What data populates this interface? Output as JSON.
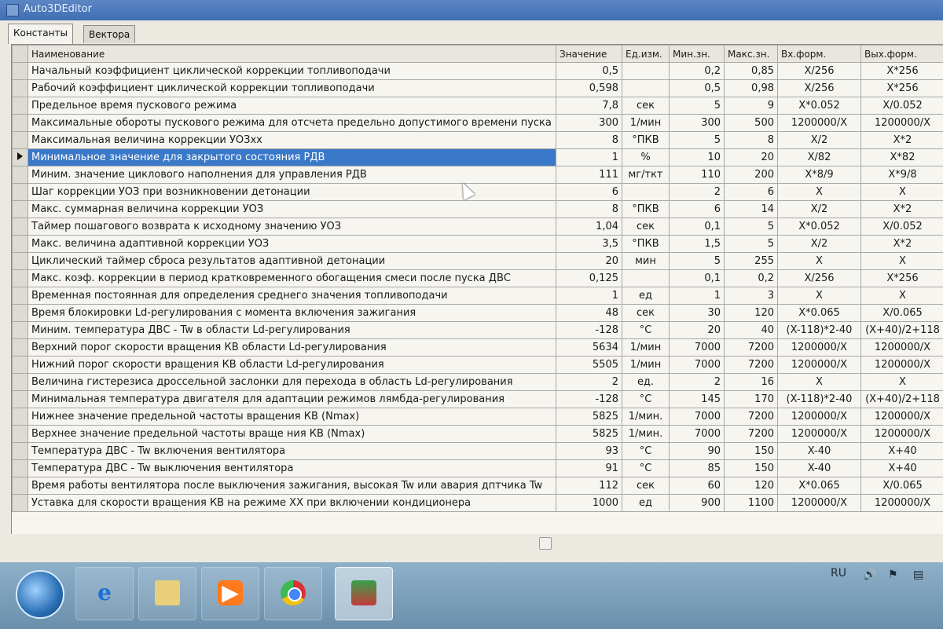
{
  "window": {
    "title": "Auto3DEditor"
  },
  "tabs": [
    {
      "label": "Константы",
      "active": true
    },
    {
      "label": "Вектора",
      "active": false
    }
  ],
  "grid": {
    "columns": [
      "Наименование",
      "Значение",
      "Ед.изм.",
      "Мин.зн.",
      "Макс.зн.",
      "Вх.форм.",
      "Вых.форм."
    ],
    "selected_row": 5,
    "rows": [
      [
        "Начальный коэффициент циклической коррекции топливоподачи",
        "0,5",
        "",
        "0,2",
        "0,85",
        "X/256",
        "X*256"
      ],
      [
        "Рабочий коэффициент циклической коррекции топливоподачи",
        "0,598",
        "",
        "0,5",
        "0,98",
        "X/256",
        "X*256"
      ],
      [
        "Предельное время пускового режима",
        "7,8",
        "сек",
        "5",
        "9",
        "X*0.052",
        "X/0.052"
      ],
      [
        "Максимальные обороты пускового режима для отсчета предельно допустимого времени пуска",
        "300",
        "1/мин",
        "300",
        "500",
        "1200000/X",
        "1200000/X"
      ],
      [
        "Максимальная величина коррекции УОЗхх",
        "8",
        "°ПКВ",
        "5",
        "8",
        "X/2",
        "X*2"
      ],
      [
        "Минимальное значение для закрытого состояния РДВ",
        "1",
        "%",
        "10",
        "20",
        "X/82",
        "X*82"
      ],
      [
        "Миним. значение циклового наполнения для управления РДВ",
        "111",
        "мг/ткт",
        "110",
        "200",
        "X*8/9",
        "X*9/8"
      ],
      [
        "Шаг коррекции УОЗ при возникновении детонации",
        "6",
        "",
        "2",
        "6",
        "X",
        "X"
      ],
      [
        "Макс. суммарная величина коррекции УОЗ",
        "8",
        "°ПКВ",
        "6",
        "14",
        "X/2",
        "X*2"
      ],
      [
        "Таймер пошагового возврата к исходному значению УОЗ",
        "1,04",
        "сек",
        "0,1",
        "5",
        "X*0.052",
        "X/0.052"
      ],
      [
        "Макс. величина адаптивной коррекции УОЗ",
        "3,5",
        "°ПКВ",
        "1,5",
        "5",
        "X/2",
        "X*2"
      ],
      [
        "Циклический таймер сброса результатов адаптивной детонации",
        "20",
        "мин",
        "5",
        "255",
        "X",
        "X"
      ],
      [
        "Макс. коэф. коррекции в период кратковременного обогащения смеси после пуска ДВС",
        "0,125",
        "",
        "0,1",
        "0,2",
        "X/256",
        "X*256"
      ],
      [
        "Временная постоянная для определения среднего значения топливоподачи",
        "1",
        "ед",
        "1",
        "3",
        "X",
        "X"
      ],
      [
        "Время блокировки Ld-регулирования с момента включения зажигания",
        "48",
        "сек",
        "30",
        "120",
        "X*0.065",
        "X/0.065"
      ],
      [
        "Миним. температура ДВС - Tw в области Ld-регулирования",
        "-128",
        "°C",
        "20",
        "40",
        "(X-118)*2-40",
        "(X+40)/2+118"
      ],
      [
        "Верхний порог скорости вращения КВ области Ld-регулирования",
        "5634",
        "1/мин",
        "7000",
        "7200",
        "1200000/X",
        "1200000/X"
      ],
      [
        "Нижний порог скорости вращения КВ области Ld-регулирования",
        "5505",
        "1/мин",
        "7000",
        "7200",
        "1200000/X",
        "1200000/X"
      ],
      [
        "Величина гистерезиса дроссельной заслонки для перехода в область Ld-регулирования",
        "2",
        "ед.",
        "2",
        "16",
        "X",
        "X"
      ],
      [
        "Минимальная температура двигателя для адаптации режимов лямбда-регулирования",
        "-128",
        "°C",
        "145",
        "170",
        "(X-118)*2-40",
        "(X+40)/2+118"
      ],
      [
        "Нижнее значение предельной частоты вращения КВ (Nmax)",
        "5825",
        "1/мин.",
        "7000",
        "7200",
        "1200000/X",
        "1200000/X"
      ],
      [
        "Верхнее значение предельной частоты враще ния КВ (Nmax)",
        "5825",
        "1/мин.",
        "7000",
        "7200",
        "1200000/X",
        "1200000/X"
      ],
      [
        "Температура ДВС - Tw включения вентилятора",
        "93",
        "°C",
        "90",
        "150",
        "X-40",
        "X+40"
      ],
      [
        "Температура ДВС - Tw выключения вентилятора",
        "91",
        "°C",
        "85",
        "150",
        "X-40",
        "X+40"
      ],
      [
        "Время работы вентилятора после выключения зажигания, высокая Tw или авария дптчика Tw",
        "112",
        "сек",
        "60",
        "120",
        "X*0.065",
        "X/0.065"
      ],
      [
        "Уставка для скорости вращения КВ на режиме XX при включении кондиционера",
        "1000",
        "ед",
        "900",
        "1100",
        "1200000/X",
        "1200000/X"
      ]
    ]
  },
  "taskbar": {
    "language": "RU",
    "buttons": [
      {
        "name": "ie-button",
        "glyph": "e"
      },
      {
        "name": "explorer-button",
        "glyph": ""
      },
      {
        "name": "media-player-button",
        "glyph": "▶"
      },
      {
        "name": "chrome-button",
        "glyph": ""
      },
      {
        "name": "auto3deditor-button",
        "glyph": ""
      }
    ]
  },
  "colors": {
    "selection": "#3a78c8",
    "grid_bg": "#f6f5f0",
    "taskbar": "#7d9fbb"
  }
}
